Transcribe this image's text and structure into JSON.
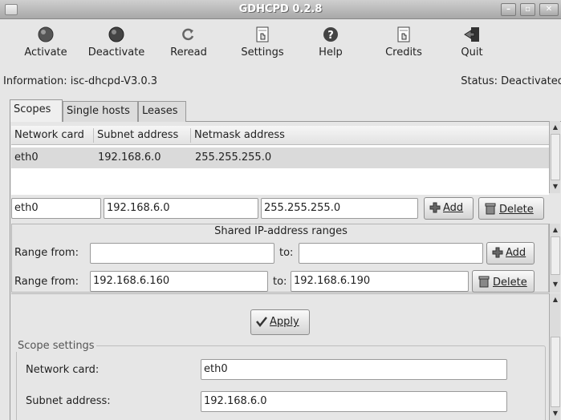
{
  "window": {
    "title": "GDHCPD 0.2.8"
  },
  "toolbar": {
    "activate": "Activate",
    "deactivate": "Deactivate",
    "reread": "Reread",
    "settings": "Settings",
    "help": "Help",
    "credits": "Credits",
    "quit": "Quit"
  },
  "info": {
    "information": "Information: isc-dhcpd-V3.0.3",
    "status": "Status: Deactivated"
  },
  "tabs": [
    "Scopes",
    "Single hosts",
    "Leases"
  ],
  "scopes_table": {
    "columns": [
      "Network card",
      "Subnet address",
      "Netmask address"
    ],
    "rows": [
      {
        "network_card": "eth0",
        "subnet": "192.168.6.0",
        "netmask": "255.255.255.0"
      }
    ]
  },
  "scope_entry": {
    "network_card": "eth0",
    "subnet": "192.168.6.0",
    "netmask": "255.255.255.0",
    "add_label": "Add",
    "delete_label": "Delete"
  },
  "shared_ranges": {
    "header": "Shared IP-address ranges",
    "range_from_label": "Range from:",
    "to_label": "to:",
    "new_from": "",
    "new_to": "",
    "add_label": "Add",
    "existing_from": "192.168.6.160",
    "existing_to": "192.168.6.190",
    "delete_label": "Delete"
  },
  "apply_label": "Apply",
  "scope_settings": {
    "title": "Scope settings",
    "network_card_label": "Network card:",
    "network_card_value": "eth0",
    "subnet_label": "Subnet address:",
    "subnet_value": "192.168.6.0"
  }
}
